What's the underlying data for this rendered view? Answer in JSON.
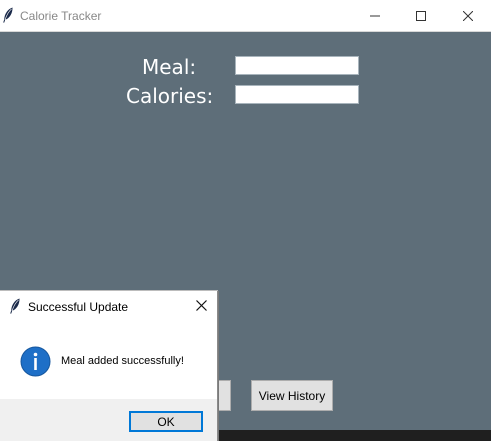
{
  "window": {
    "title": "Calorie Tracker",
    "icon": "tk-feather-icon",
    "controls": [
      "minimize-icon",
      "maximize-icon",
      "close-icon"
    ]
  },
  "form": {
    "meal_label": "Meal:",
    "meal_value": "",
    "calories_label": "Calories:",
    "calories_value": ""
  },
  "buttons": {
    "view_history": "View History"
  },
  "dialog": {
    "title": "Successful Update",
    "icon": "info-icon",
    "message": "Meal added successfully!",
    "ok_label": "OK"
  },
  "colors": {
    "window_background": "#5e6e79",
    "dialog_focus": "#0078d7",
    "info_icon": "#1e6fc7"
  }
}
